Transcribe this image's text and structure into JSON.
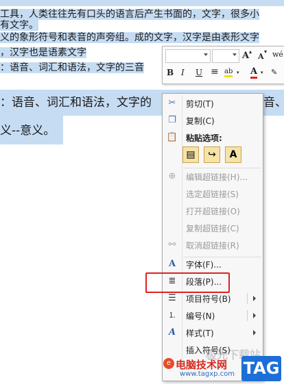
{
  "document": {
    "lines": [
      "工具，人类往往先有口头的语言后产生书面的，文字，很多小",
      "有文字。",
      "义的象形符号和表音的声旁组。成的文字，汉字是由表形文字",
      "，汉字也是语素文字",
      "：语音、词汇和语法，文字的三音"
    ],
    "big_lines": [
      "：语音、词汇和语法，文字的",
      "音、",
      "义--意义。"
    ]
  },
  "mini_toolbar": {
    "grow_font": "A",
    "shrink_font": "A",
    "bold": "B",
    "italic": "I",
    "underline": "U",
    "align": "≡",
    "highlight": "ab",
    "font_color": "A",
    "phonetic": "wén"
  },
  "menu": {
    "cut": "剪切(T)",
    "copy": "复制(C)",
    "paste_options": "粘贴选项:",
    "edit_hyperlink": "编辑超链接(H)...",
    "select_hyperlink": "选定超链接(S)",
    "open_hyperlink": "打开超链接(O)",
    "copy_hyperlink": "复制超链接(C)",
    "remove_hyperlink": "取消超链接(R)",
    "font": "字体(F)...",
    "paragraph": "段落(P)...",
    "bullets": "项目符号(B)",
    "numbering": "编号(N)",
    "styles": "样式(T)",
    "insert_symbol": "插入符号(S)",
    "paste_letter": "A"
  },
  "watermark": {
    "site_name": "电脑技术网",
    "url": "www.tagxp.com",
    "tag": "TAG",
    "faint_text": "极光下载站"
  },
  "colors": {
    "selection": "#c5dcf3",
    "highlight_box": "#e02020",
    "tag_blue": "#1c6fd6"
  }
}
